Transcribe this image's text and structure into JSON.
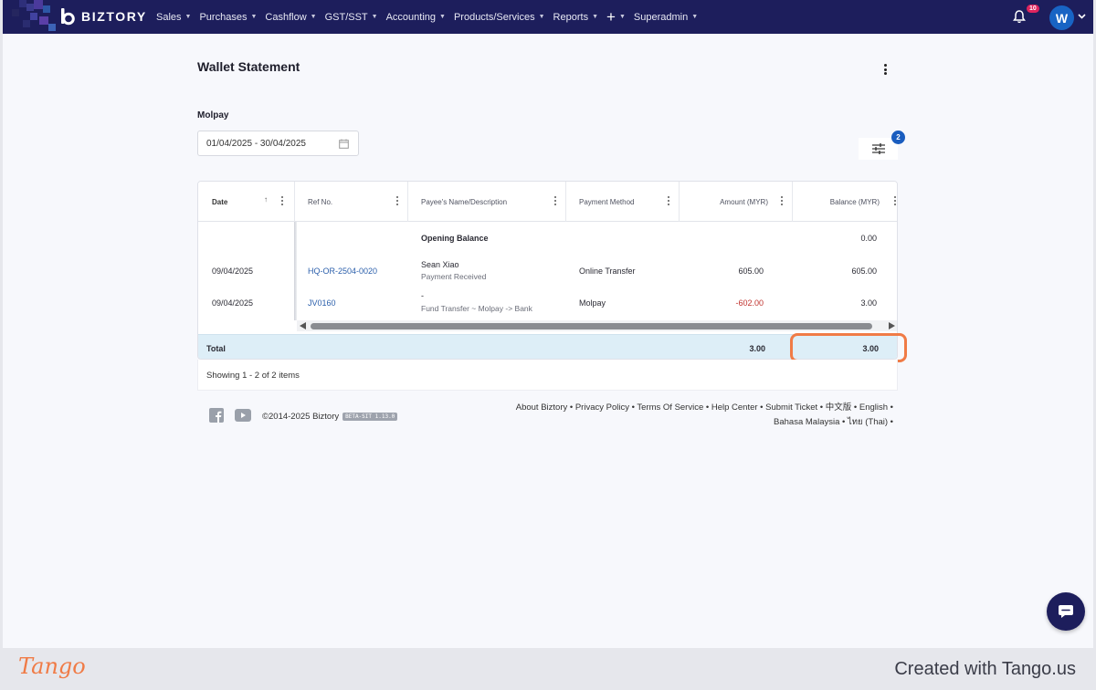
{
  "app": {
    "name": "BIZTORY"
  },
  "nav": {
    "items": [
      "Sales",
      "Purchases",
      "Cashflow",
      "GST/SST",
      "Accounting",
      "Products/Services",
      "Reports",
      "+",
      "Superadmin"
    ],
    "notification_count": "10",
    "avatar_initial": "W"
  },
  "page": {
    "title": "Wallet Statement",
    "account_name": "Molpay",
    "date_range": "01/04/2025 - 30/04/2025",
    "filter_badge": "2"
  },
  "table": {
    "columns": [
      "Date",
      "Ref No.",
      "Payee's Name/Description",
      "Payment Method",
      "Amount (MYR)",
      "Balance (MYR)"
    ],
    "opening": {
      "label": "Opening Balance",
      "balance": "0.00"
    },
    "rows": [
      {
        "date": "09/04/2025",
        "ref": "HQ-OR-2504-0020",
        "payee": "Sean Xiao",
        "description": "Payment Received",
        "method": "Online Transfer",
        "amount": "605.00",
        "balance": "605.00"
      },
      {
        "date": "09/04/2025",
        "ref": "JV0160",
        "payee": "-",
        "description": "Fund Transfer ~ Molpay -> Bank",
        "method": "Molpay",
        "amount": "-602.00",
        "balance": "3.00"
      }
    ],
    "total": {
      "label": "Total",
      "amount": "3.00",
      "balance": "3.00"
    },
    "showing": "Showing 1 - 2 of 2 items"
  },
  "footer": {
    "copyright": "©2014-2025 Biztory",
    "version": "BETA-SIT 1.13.0",
    "links_line1": "About Biztory • Privacy Policy • Terms Of Service • Help Center • Submit Ticket • 中文版 • English •",
    "links_line2": "Bahasa Malaysia • ไทย (Thai) •"
  },
  "tango": {
    "logo": "Tango",
    "credit": "Created with Tango.us"
  },
  "colors": {
    "nav_bg": "#1d1e5c",
    "accent": "#1a5dbf",
    "highlight": "#f07b46",
    "negative": "#c0322d",
    "total_row": "#ddeef7"
  }
}
